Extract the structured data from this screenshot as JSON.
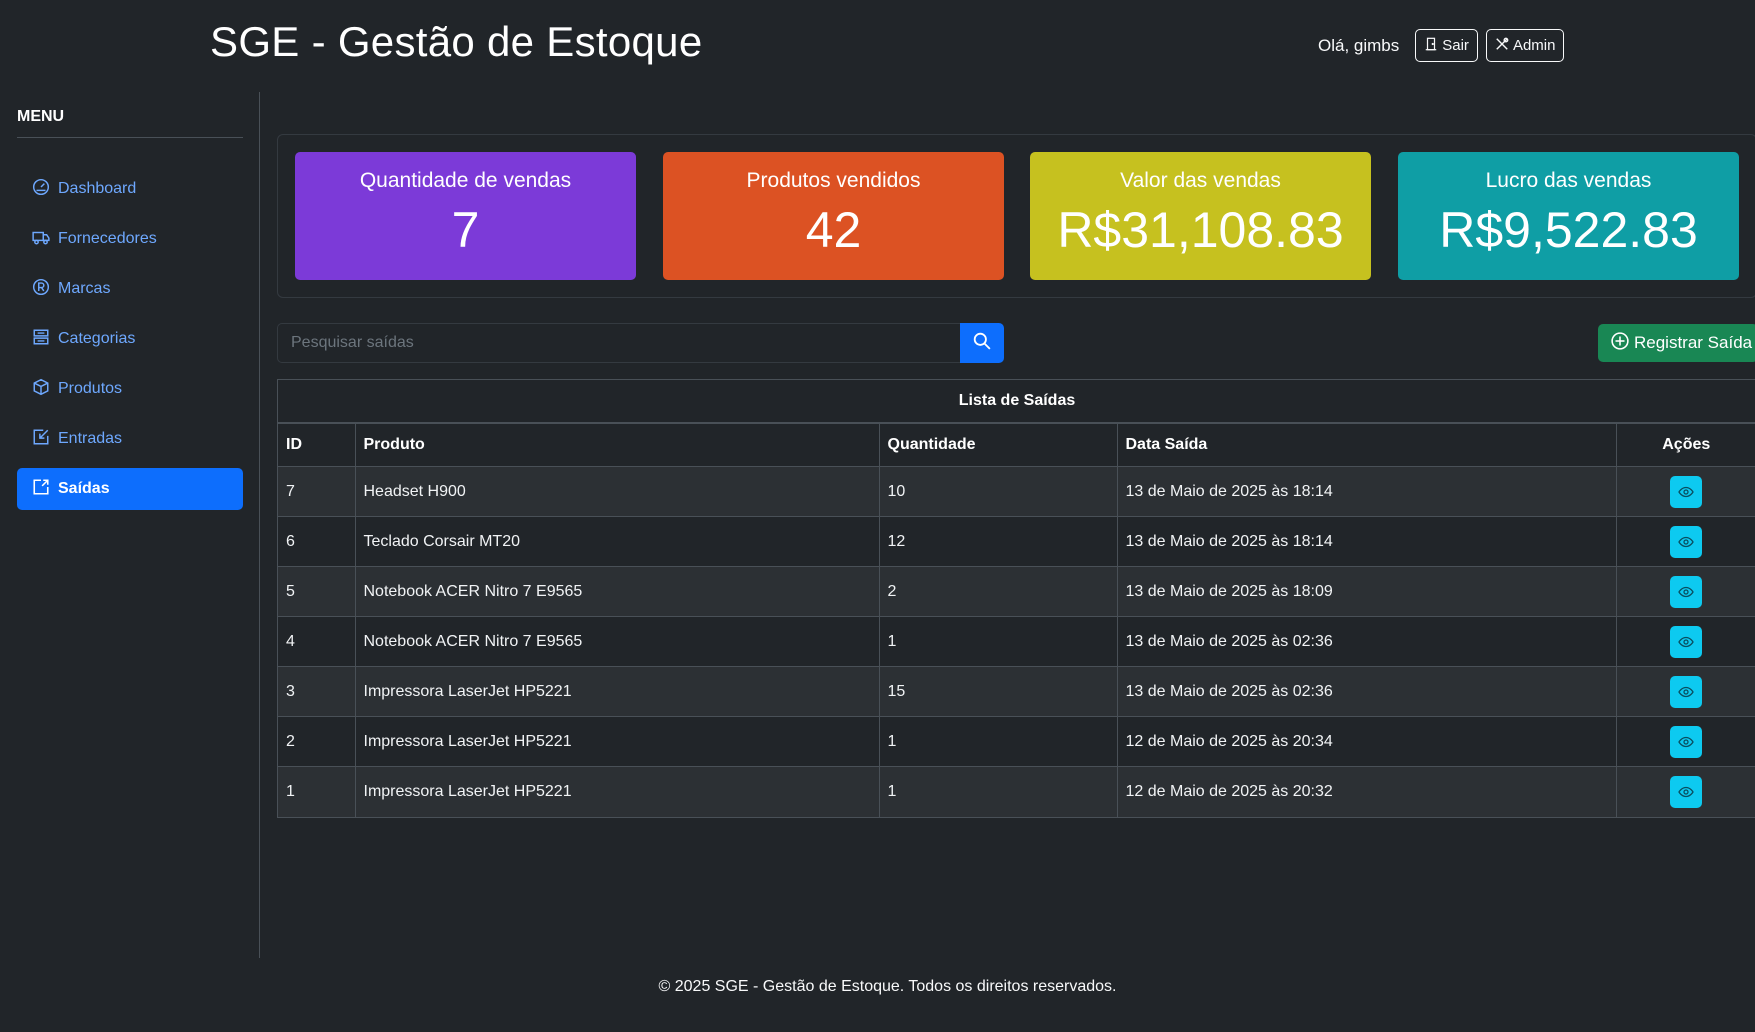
{
  "header": {
    "title": "SGE - Gestão de Estoque",
    "greeting": "Olá, gimbs",
    "logout_label": "Sair",
    "admin_label": "Admin"
  },
  "sidebar": {
    "menu_title": "MENU",
    "items": [
      {
        "label": "Dashboard",
        "icon": "speedometer-icon"
      },
      {
        "label": "Fornecedores",
        "icon": "truck-icon"
      },
      {
        "label": "Marcas",
        "icon": "registered-icon"
      },
      {
        "label": "Categorias",
        "icon": "inboxes-icon"
      },
      {
        "label": "Produtos",
        "icon": "box-icon"
      },
      {
        "label": "Entradas",
        "icon": "box-arrow-in-icon"
      },
      {
        "label": "Saídas",
        "icon": "box-arrow-up-right-icon",
        "active": true
      }
    ]
  },
  "stats": [
    {
      "label": "Quantidade de vendas",
      "value": "7",
      "color": "#7c3ad8"
    },
    {
      "label": "Produtos vendidos",
      "value": "42",
      "color": "#dc5223"
    },
    {
      "label": "Valor das vendas",
      "value": "R$31,108.83",
      "color": "#c6c11f"
    },
    {
      "label": "Lucro das vendas",
      "value": "R$9,522.83",
      "color": "#0f9ea5"
    }
  ],
  "search": {
    "placeholder": "Pesquisar saídas",
    "value": ""
  },
  "actions": {
    "register_label": "Registrar Saída"
  },
  "table": {
    "caption": "Lista de Saídas",
    "columns": [
      "ID",
      "Produto",
      "Quantidade",
      "Data Saída",
      "Ações"
    ],
    "rows": [
      {
        "id": "7",
        "produto": "Headset H900",
        "quantidade": "10",
        "data": "13 de Maio de 2025 às 18:14"
      },
      {
        "id": "6",
        "produto": "Teclado Corsair MT20",
        "quantidade": "12",
        "data": "13 de Maio de 2025 às 18:14"
      },
      {
        "id": "5",
        "produto": "Notebook ACER Nitro 7 E9565",
        "quantidade": "2",
        "data": "13 de Maio de 2025 às 18:09"
      },
      {
        "id": "4",
        "produto": "Notebook ACER Nitro 7 E9565",
        "quantidade": "1",
        "data": "13 de Maio de 2025 às 02:36"
      },
      {
        "id": "3",
        "produto": "Impressora LaserJet HP5221",
        "quantidade": "15",
        "data": "13 de Maio de 2025 às 02:36"
      },
      {
        "id": "2",
        "produto": "Impressora LaserJet HP5221",
        "quantidade": "1",
        "data": "12 de Maio de 2025 às 20:34"
      },
      {
        "id": "1",
        "produto": "Impressora LaserJet HP5221",
        "quantidade": "1",
        "data": "12 de Maio de 2025 às 20:32"
      }
    ]
  },
  "footer": {
    "text": "© 2025 SGE - Gestão de Estoque. Todos os direitos reservados."
  }
}
